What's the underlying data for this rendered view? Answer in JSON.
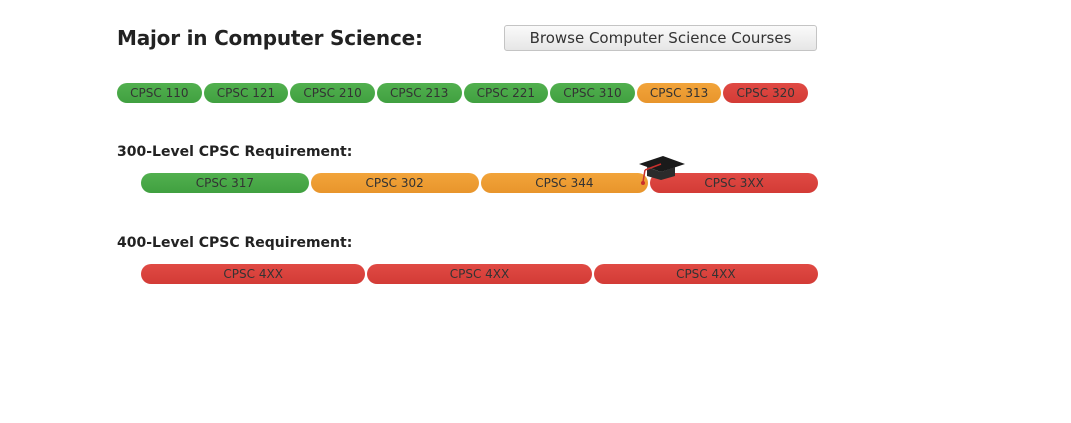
{
  "header": {
    "title": "Major in Computer Science:",
    "browse_button": "Browse Computer Science Courses"
  },
  "core_courses": [
    {
      "label": "CPSC 110",
      "status": "green"
    },
    {
      "label": "CPSC 121",
      "status": "green"
    },
    {
      "label": "CPSC 210",
      "status": "green"
    },
    {
      "label": "CPSC 213",
      "status": "green"
    },
    {
      "label": "CPSC 221",
      "status": "green"
    },
    {
      "label": "CPSC 310",
      "status": "green"
    },
    {
      "label": "CPSC 313",
      "status": "orange"
    },
    {
      "label": "CPSC 320",
      "status": "red"
    }
  ],
  "level_300": {
    "label": "300-Level CPSC Requirement:",
    "courses": [
      {
        "label": "CPSC 317",
        "status": "green"
      },
      {
        "label": "CPSC 302",
        "status": "orange"
      },
      {
        "label": "CPSC 344",
        "status": "orange"
      },
      {
        "label": "CPSC 3XX",
        "status": "red"
      }
    ]
  },
  "level_400": {
    "label": "400-Level CPSC Requirement:",
    "courses": [
      {
        "label": "CPSC 4XX",
        "status": "red"
      },
      {
        "label": "CPSC 4XX",
        "status": "red"
      },
      {
        "label": "CPSC 4XX",
        "status": "red"
      }
    ]
  },
  "icons": {
    "graduation": "graduation-cap-icon"
  },
  "colors": {
    "green": "#4aa847",
    "orange": "#eea033",
    "red": "#d9413c"
  }
}
